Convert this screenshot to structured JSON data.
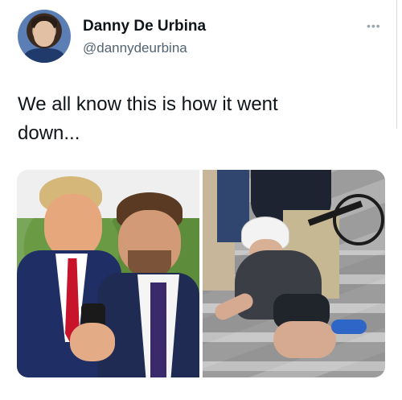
{
  "author": {
    "name": "Danny De Urbina",
    "handle": "@dannydeurbina"
  },
  "tweet": {
    "text": "We all know this is how it went\ndown..."
  },
  "more_icon": "more-horizontal-icon",
  "media": {
    "count": 2
  }
}
